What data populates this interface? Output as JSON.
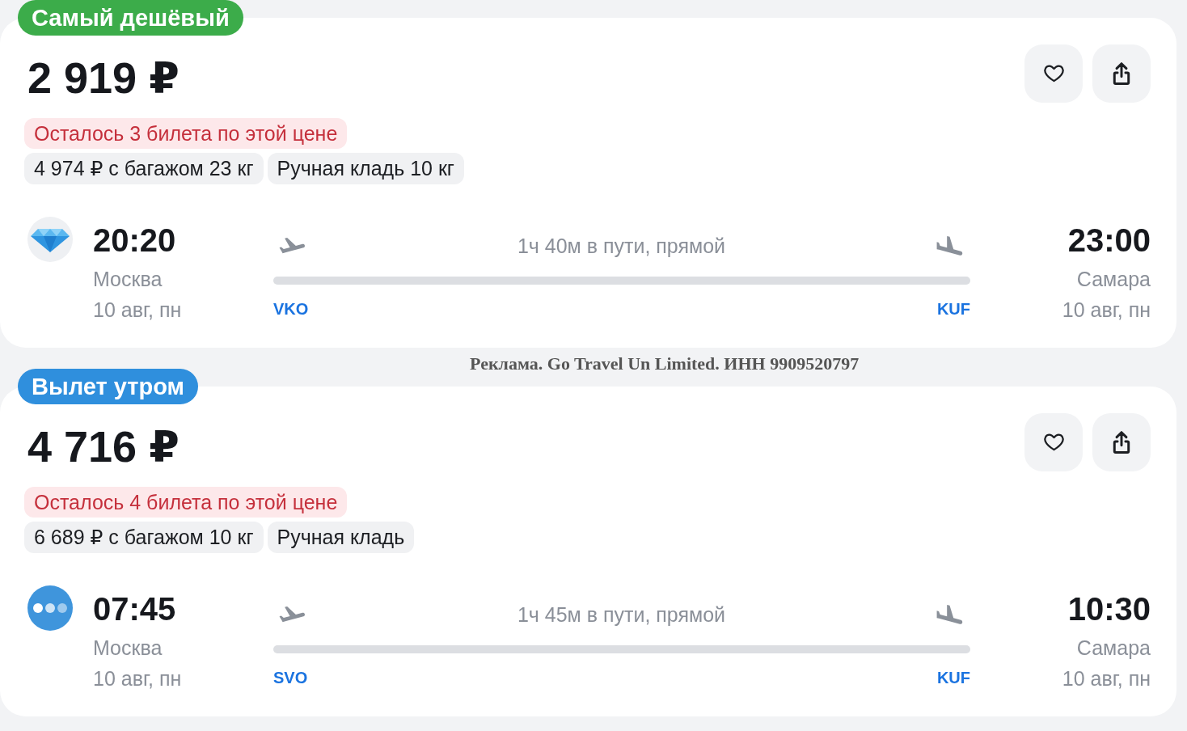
{
  "offers": [
    {
      "badge": {
        "text": "Самый дешёвый",
        "color": "#3cac4a"
      },
      "price": "2 919 ₽",
      "seats_left": "Осталось 3 билета по этой цене",
      "fare_options": [
        "4 974 ₽ с багажом 23 кг",
        "Ручная кладь 10 кг"
      ],
      "flight": {
        "airline_logo": {
          "kind": "diamond"
        },
        "departure": {
          "time": "20:20",
          "city": "Москва",
          "date": "10 авг, пн",
          "airport": "VKO"
        },
        "duration": "1ч 40м в пути, прямой",
        "arrival": {
          "time": "23:00",
          "city": "Самара",
          "date": "10 авг, пн",
          "airport": "KUF"
        }
      }
    },
    {
      "badge": {
        "text": "Вылет утром",
        "color": "#2f8fdd"
      },
      "price": "4 716 ₽",
      "seats_left": "Осталось 4 билета по этой цене",
      "fare_options": [
        "6 689 ₽ с багажом 10 кг",
        "Ручная кладь"
      ],
      "flight": {
        "airline_logo": {
          "kind": "dots"
        },
        "departure": {
          "time": "07:45",
          "city": "Москва",
          "date": "10 авг, пн",
          "airport": "SVO"
        },
        "duration": "1ч 45м в пути, прямой",
        "arrival": {
          "time": "10:30",
          "city": "Самара",
          "date": "10 авг, пн",
          "airport": "KUF"
        }
      }
    }
  ],
  "ad_notice": "Реклама. Go Travel Un Limited. ИНН 9909520797"
}
